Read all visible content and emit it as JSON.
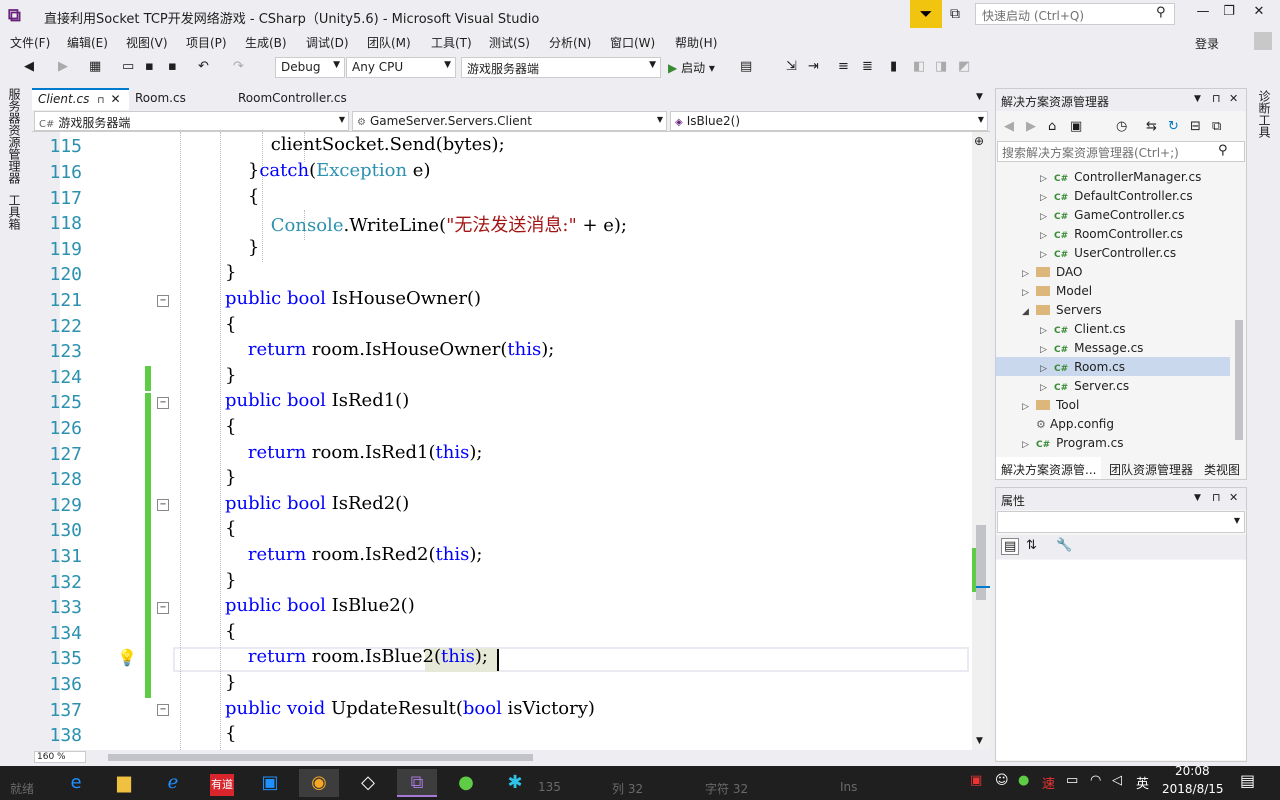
{
  "window": {
    "title": "直接利用Socket TCP开发网络游戏 - CSharp（Unity5.6) - Microsoft Visual Studio",
    "quick_launch_placeholder": "快速启动 (Ctrl+Q)",
    "login_label": "登录"
  },
  "menu": [
    "文件(F)",
    "编辑(E)",
    "视图(V)",
    "项目(P)",
    "生成(B)",
    "调试(D)",
    "团队(M)",
    "工具(T)",
    "测试(S)",
    "分析(N)",
    "窗口(W)",
    "帮助(H)"
  ],
  "toolbar": {
    "config": "Debug",
    "platform": "Any CPU",
    "startup_project": "游戏服务器端",
    "start_label": "启动"
  },
  "left_rail": [
    "服务器资源管理器",
    "工具箱"
  ],
  "right_rail": [
    "诊断工具"
  ],
  "doc_tabs": [
    {
      "label": "Client.cs",
      "active": true
    },
    {
      "label": "Room.cs",
      "active": false
    },
    {
      "label": "RoomController.cs",
      "active": false
    }
  ],
  "nav": {
    "project": "游戏服务器端",
    "class": "GameServer.Servers.Client",
    "member": "IsBlue2()"
  },
  "editor": {
    "zoom": "160 %",
    "lines": [
      {
        "num": "115",
        "text": "        clientSocket.Send(bytes);"
      },
      {
        "num": "116",
        "text": "    }catch(Exception e)"
      },
      {
        "num": "117",
        "text": "    {"
      },
      {
        "num": "118",
        "text": "        Console.WriteLine(\"无法发送消息:\" + e);"
      },
      {
        "num": "119",
        "text": "    }"
      },
      {
        "num": "120",
        "text": "}"
      },
      {
        "num": "121",
        "text": "public bool IsHouseOwner()"
      },
      {
        "num": "122",
        "text": "{"
      },
      {
        "num": "123",
        "text": "    return room.IsHouseOwner(this);"
      },
      {
        "num": "124",
        "text": "}"
      },
      {
        "num": "125",
        "text": "public bool IsRed1()"
      },
      {
        "num": "126",
        "text": "{"
      },
      {
        "num": "127",
        "text": "    return room.IsRed1(this);"
      },
      {
        "num": "128",
        "text": "}"
      },
      {
        "num": "129",
        "text": "public bool IsRed2()"
      },
      {
        "num": "130",
        "text": "{"
      },
      {
        "num": "131",
        "text": "    return room.IsRed2(this);"
      },
      {
        "num": "132",
        "text": "}"
      },
      {
        "num": "133",
        "text": "public bool IsBlue2()"
      },
      {
        "num": "134",
        "text": "{"
      },
      {
        "num": "135",
        "text": "    return room.IsBlue2(this);"
      },
      {
        "num": "136",
        "text": "}"
      },
      {
        "num": "137",
        "text": "public void UpdateResult(bool isVictory)"
      },
      {
        "num": "138",
        "text": "{"
      }
    ]
  },
  "solution_explorer": {
    "title": "解决方案资源管理器",
    "search_placeholder": "搜索解决方案资源管理器(Ctrl+;)",
    "items": [
      {
        "label": "ControllerManager.cs",
        "kind": "cs"
      },
      {
        "label": "DefaultController.cs",
        "kind": "cs"
      },
      {
        "label": "GameController.cs",
        "kind": "cs"
      },
      {
        "label": "RoomController.cs",
        "kind": "cs"
      },
      {
        "label": "UserController.cs",
        "kind": "cs"
      },
      {
        "label": "DAO",
        "kind": "folder"
      },
      {
        "label": "Model",
        "kind": "folder"
      },
      {
        "label": "Servers",
        "kind": "folder"
      },
      {
        "label": "Client.cs",
        "kind": "cs"
      },
      {
        "label": "Message.cs",
        "kind": "cs"
      },
      {
        "label": "Room.cs",
        "kind": "cs",
        "selected": true
      },
      {
        "label": "Server.cs",
        "kind": "cs"
      },
      {
        "label": "Tool",
        "kind": "folder"
      },
      {
        "label": "App.config",
        "kind": "config"
      },
      {
        "label": "Program.cs",
        "kind": "cs"
      }
    ],
    "bottom_tabs": [
      "解决方案资源管...",
      "团队资源管理器",
      "类视图"
    ]
  },
  "properties": {
    "title": "属性"
  },
  "statusbar_ghost": {
    "ready": "就绪",
    "line": "135",
    "col": "列 32",
    "char": "字符 32",
    "ins": "Ins"
  },
  "taskbar": {
    "time": "20:08",
    "date": "2018/8/15",
    "ime": "英"
  }
}
